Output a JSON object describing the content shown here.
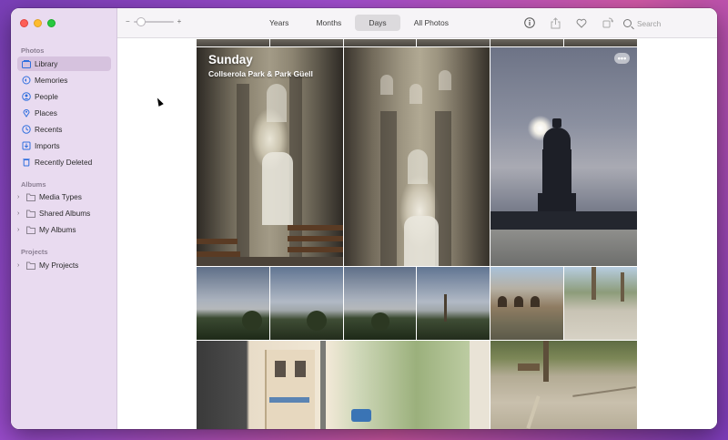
{
  "sidebar": {
    "sections": {
      "photos": "Photos",
      "albums": "Albums",
      "projects": "Projects"
    },
    "items": [
      {
        "label": "Library",
        "icon": "library-icon"
      },
      {
        "label": "Memories",
        "icon": "memories-icon"
      },
      {
        "label": "People",
        "icon": "people-icon"
      },
      {
        "label": "Places",
        "icon": "places-icon"
      },
      {
        "label": "Recents",
        "icon": "recents-icon"
      },
      {
        "label": "Imports",
        "icon": "imports-icon"
      },
      {
        "label": "Recently Deleted",
        "icon": "trash-icon"
      }
    ],
    "albums": [
      {
        "label": "Media Types"
      },
      {
        "label": "Shared Albums"
      },
      {
        "label": "My Albums"
      }
    ],
    "projects": [
      {
        "label": "My Projects"
      }
    ]
  },
  "toolbar": {
    "zoom_minus": "−",
    "zoom_plus": "+",
    "tabs": [
      "Years",
      "Months",
      "Days",
      "All Photos"
    ],
    "active_tab": "Days",
    "search_placeholder": "Search"
  },
  "day": {
    "title": "Sunday",
    "subtitle": "Collserola Park & Park Güell",
    "more": "•••"
  },
  "colors": {
    "accent": "#2f6fde",
    "sidebar_bg": "#e8daf0",
    "selected_bg": "#d6c2de"
  }
}
